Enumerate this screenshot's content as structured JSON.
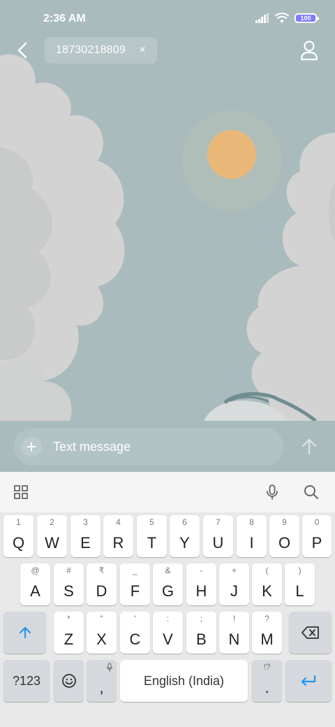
{
  "status": {
    "time": "2:36 AM",
    "battery": "100"
  },
  "header": {
    "recipient": "18730218809",
    "chip_close": "×"
  },
  "composer": {
    "placeholder": "Text message",
    "plus": "+"
  },
  "keyboard": {
    "row1": [
      {
        "hint": "1",
        "key": "Q"
      },
      {
        "hint": "2",
        "key": "W"
      },
      {
        "hint": "3",
        "key": "E"
      },
      {
        "hint": "4",
        "key": "R"
      },
      {
        "hint": "5",
        "key": "T"
      },
      {
        "hint": "6",
        "key": "Y"
      },
      {
        "hint": "7",
        "key": "U"
      },
      {
        "hint": "8",
        "key": "I"
      },
      {
        "hint": "9",
        "key": "O"
      },
      {
        "hint": "0",
        "key": "P"
      }
    ],
    "row2": [
      {
        "hint": "@",
        "key": "A"
      },
      {
        "hint": "#",
        "key": "S"
      },
      {
        "hint": "₹",
        "key": "D"
      },
      {
        "hint": "_",
        "key": "F"
      },
      {
        "hint": "&",
        "key": "G"
      },
      {
        "hint": "-",
        "key": "H"
      },
      {
        "hint": "+",
        "key": "J"
      },
      {
        "hint": "(",
        "key": "K"
      },
      {
        "hint": ")",
        "key": "L"
      }
    ],
    "row3": [
      {
        "hint": "*",
        "key": "Z"
      },
      {
        "hint": "\"",
        "key": "X"
      },
      {
        "hint": "'",
        "key": "C"
      },
      {
        "hint": ":",
        "key": "V"
      },
      {
        "hint": ";",
        "key": "B"
      },
      {
        "hint": "!",
        "key": "N"
      },
      {
        "hint": "?",
        "key": "M"
      }
    ],
    "symbols_label": "?123",
    "comma": ",",
    "space_label": "English (India)",
    "period": ".",
    "period_hint": "!?"
  },
  "colors": {
    "accent": "#2196f3",
    "wallpaper": "#a9bbbd",
    "sun": "#e9b879",
    "cloud": "#d3d3d3"
  }
}
